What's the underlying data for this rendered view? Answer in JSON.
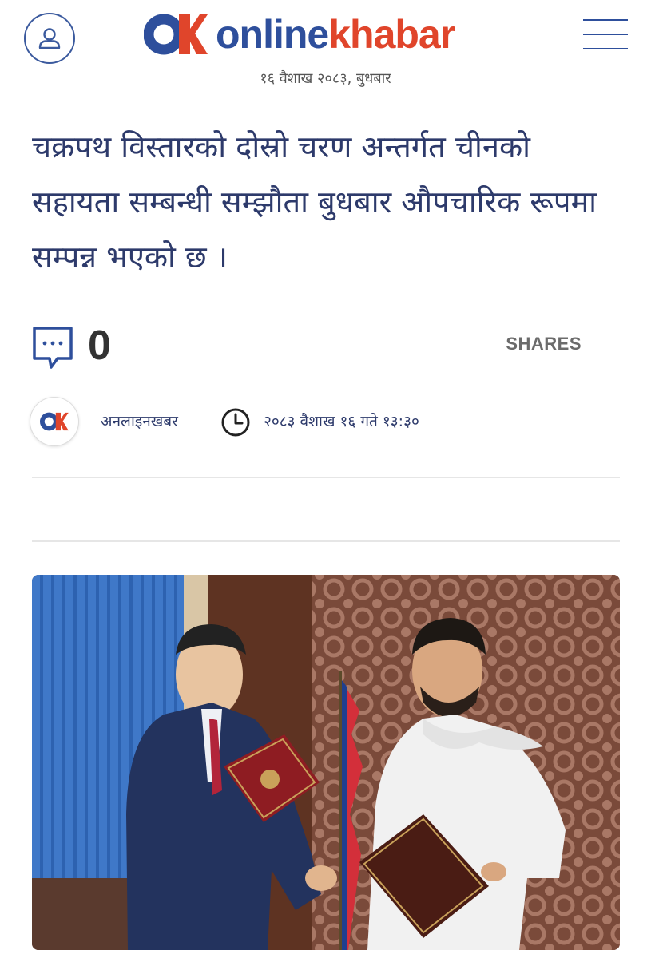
{
  "header": {
    "logo_online": "online",
    "logo_khabar": "khabar",
    "date": "१६ वैशाख २०८३, बुधबार",
    "user_icon": "user-icon",
    "menu_icon": "hamburger-menu-icon"
  },
  "article": {
    "headline": "चक्रपथ विस्तारको दोस्रो चरण अन्तर्गत चीनको सहायता सम्बन्धी सम्झौता बुधबार औपचारिक रूपमा सम्पन्न भएको छ ।",
    "comment_count": "0",
    "shares_label": "SHARES",
    "author": "अनलाइनखबर",
    "published": "२०८३ वैशाख १६ गते १३:३०"
  },
  "colors": {
    "brand_blue": "#2e4f9c",
    "brand_red": "#e0452b",
    "text": "#2d3a6b"
  }
}
